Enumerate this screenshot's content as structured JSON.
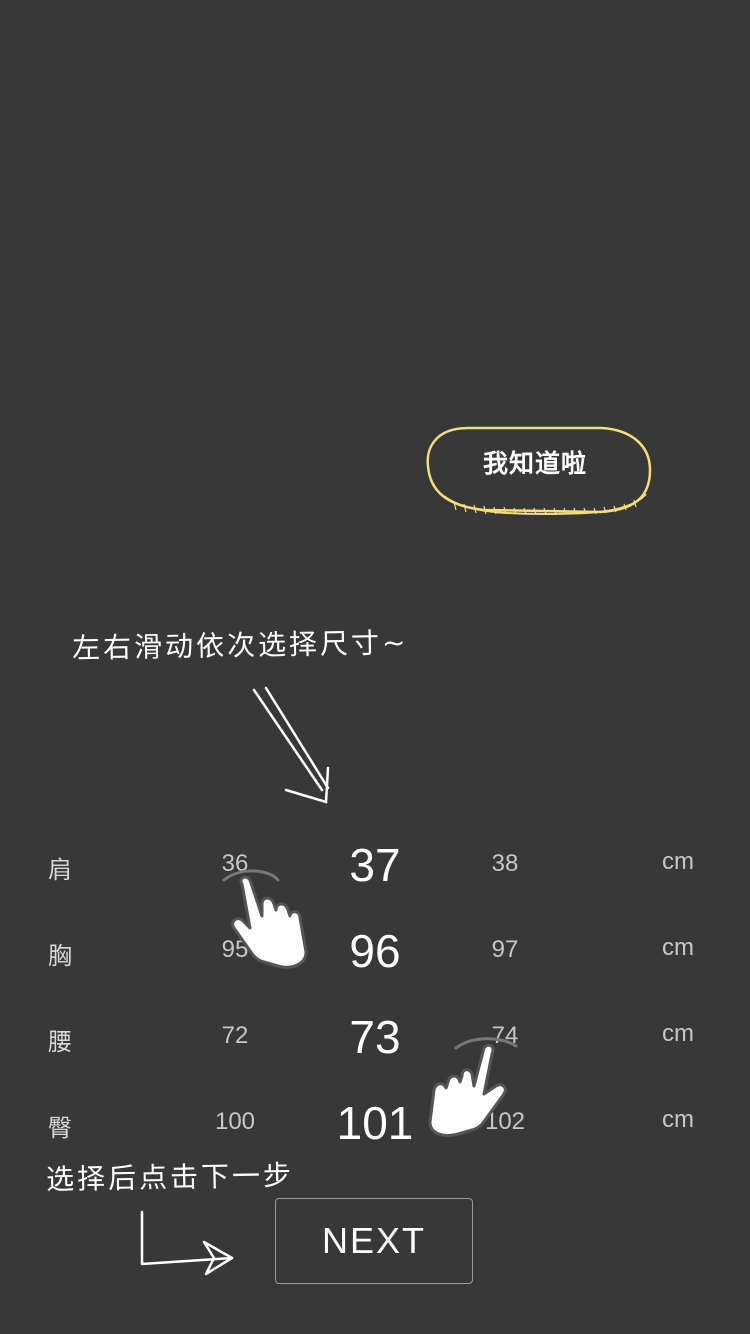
{
  "overlay": {
    "got_it_label": "我知道啦",
    "swipe_hint": "左右滑动依次选择尺寸~",
    "next_hint": "选择后点击下一步"
  },
  "picker": {
    "rows": [
      {
        "label": "肩",
        "prev": "36",
        "current": "37",
        "next": "38",
        "unit": "cm"
      },
      {
        "label": "胸",
        "prev": "95",
        "current": "96",
        "next": "97",
        "unit": "cm"
      },
      {
        "label": "腰",
        "prev": "72",
        "current": "73",
        "next": "74",
        "unit": "cm"
      },
      {
        "label": "臀",
        "prev": "100",
        "current": "101",
        "next": "102",
        "unit": "cm"
      }
    ]
  },
  "next_button": {
    "label": "NEXT"
  },
  "colors": {
    "background": "#383838",
    "accent_yellow": "#f3dd7c",
    "text": "#ffffff"
  },
  "icons": [
    "down-arrow-icon",
    "hand-swipe-icon",
    "right-arrow-icon"
  ]
}
